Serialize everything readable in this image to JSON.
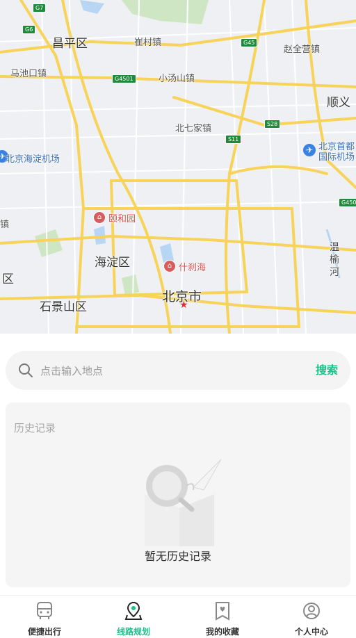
{
  "map": {
    "labels": {
      "changping": "昌平区",
      "cuicun": "崔村镇",
      "zhaoquanying": "赵全营镇",
      "machikou": "马池口镇",
      "xiaotangshan": "小汤山镇",
      "shunyi": "顺义",
      "beiqijia": "北七家镇",
      "haidian_airport": "北京海淀机场",
      "capital_airport_1": "北京首都",
      "capital_airport_2": "国际机场",
      "summer_palace": "颐和园",
      "haidian": "海淀区",
      "shichahai": "什刹海",
      "wenyu_river_1": "温",
      "wenyu_river_2": "榆",
      "wenyu_river_3": "河",
      "beijing_city": "北京市",
      "shijingshan": "石景山区",
      "edge_qu": "区",
      "edge_zhen": "镇"
    },
    "shields": {
      "g7": "G7",
      "g6": "G6",
      "g45": "G45",
      "g4501_a": "G4501",
      "s28": "S28",
      "s11": "S11",
      "g4501_b": "G450"
    },
    "colors": {
      "background": "#eef0f3",
      "road_major": "#f7d35a",
      "road_minor": "#ffffff",
      "water": "#b7d6f3",
      "green": "#cfe6c4"
    }
  },
  "search": {
    "placeholder": "点击输入地点",
    "value": "",
    "button_label": "搜索",
    "icon": "search-icon"
  },
  "history": {
    "title": "历史记录",
    "empty_text": "暂无历史记录",
    "illustration": "empty-history-illustration"
  },
  "tabs": [
    {
      "label": "便捷出行",
      "icon": "bus-icon",
      "active": false
    },
    {
      "label": "线路规划",
      "icon": "route-pin-icon",
      "active": true
    },
    {
      "label": "我的收藏",
      "icon": "favorite-heart-icon",
      "active": false
    },
    {
      "label": "个人中心",
      "icon": "user-icon",
      "active": false
    }
  ],
  "accent_color": "#1ebf8a"
}
